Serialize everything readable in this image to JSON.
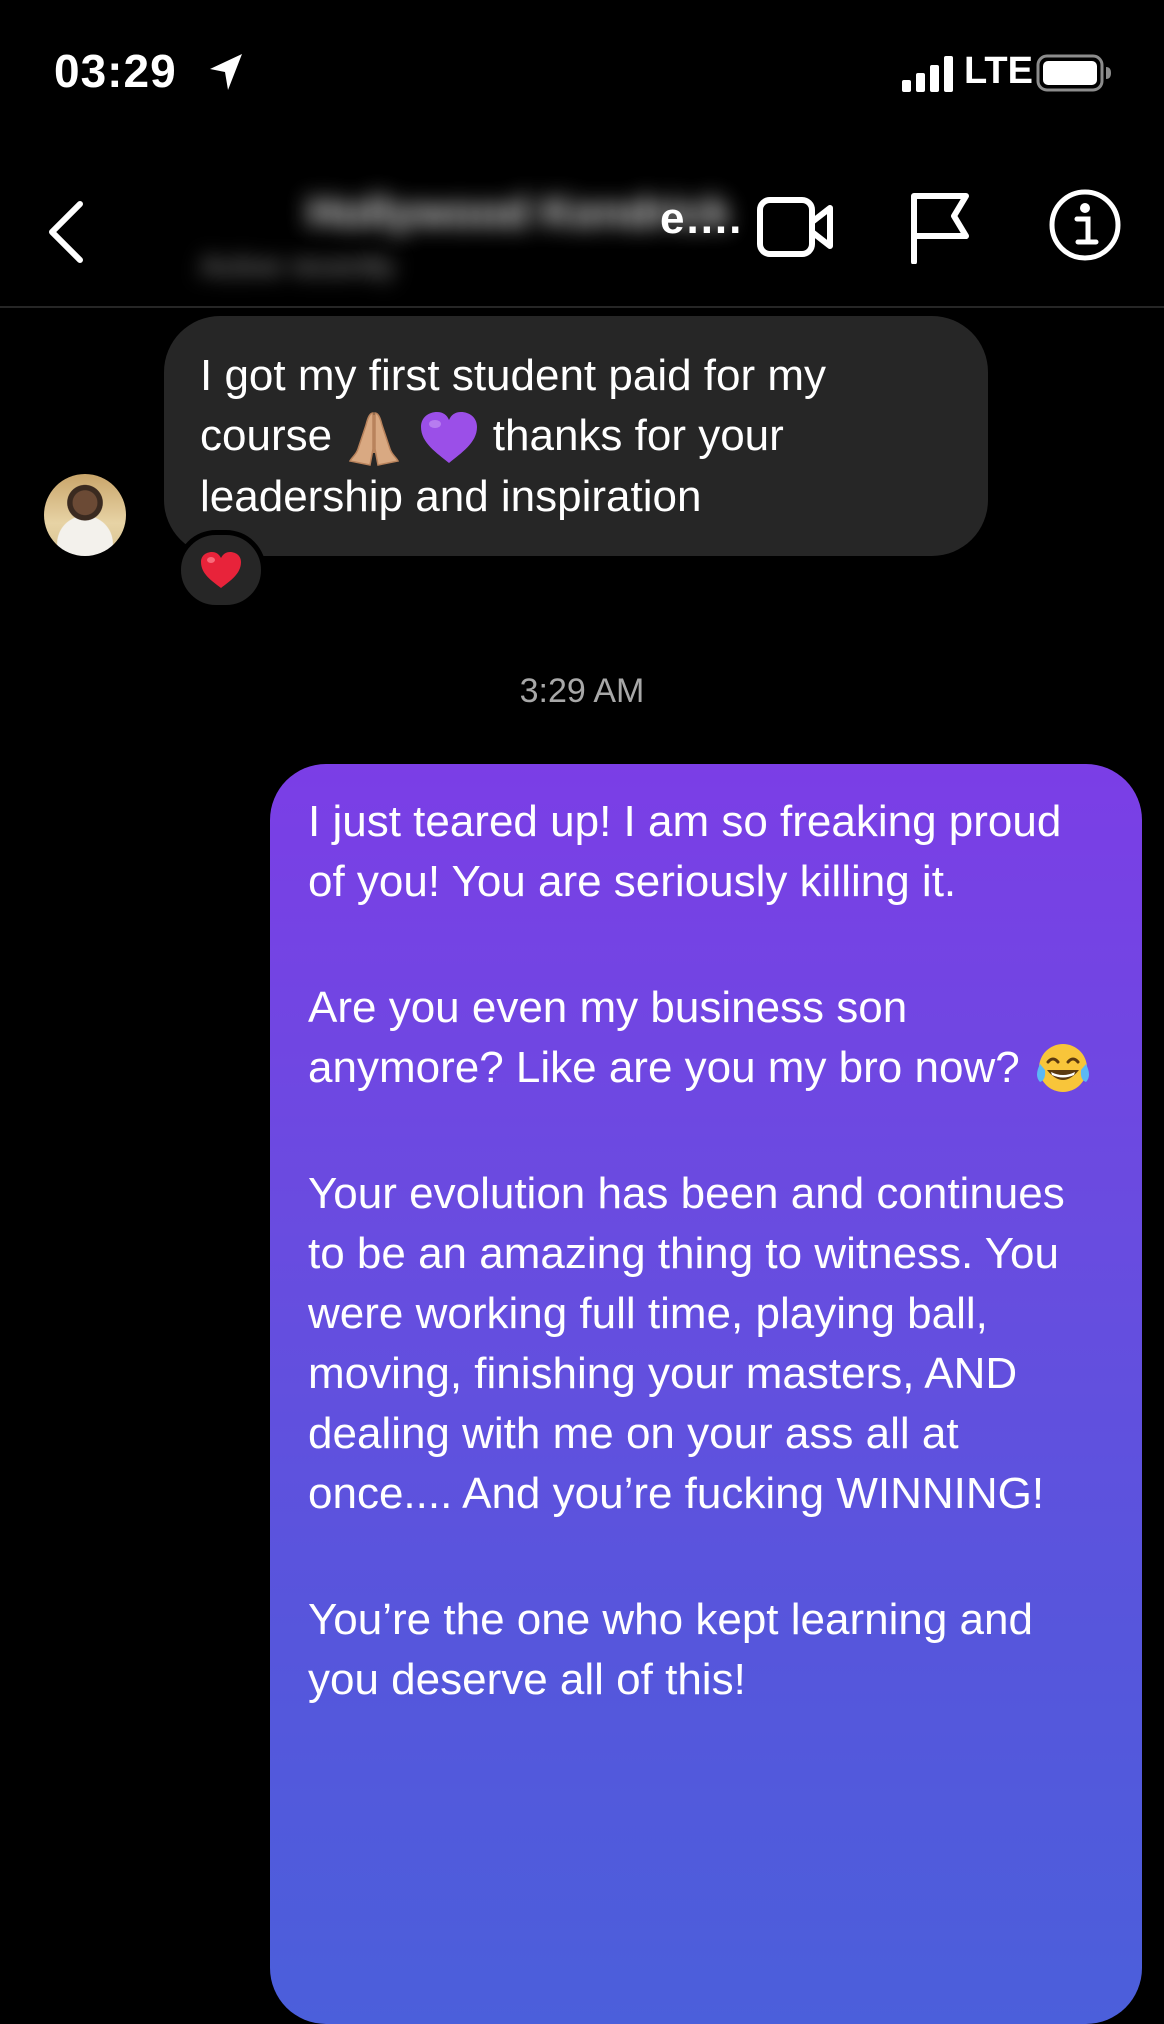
{
  "status_bar": {
    "time": "03:29",
    "network": "LTE",
    "icons": [
      "location-arrow-icon",
      "signal-bars-icon",
      "battery-icon"
    ]
  },
  "header": {
    "contact_name": "Hollywood Kendrick",
    "contact_subtitle": "Active recently",
    "name_ellipsis": "e....",
    "icons": [
      "chevron-left-icon",
      "video-camera-icon",
      "flag-icon",
      "info-icon"
    ]
  },
  "conversation": {
    "incoming": {
      "line1": "I got my first student paid for my",
      "line2_before": "course",
      "line2_after": "thanks for your",
      "line3": "leadership and inspiration",
      "emojis": [
        "praying-hands-emoji",
        "purple-heart-emoji"
      ],
      "reaction": "red-heart-emoji"
    },
    "timestamp": "3:29 AM",
    "outgoing": {
      "p1": "I just teared up! I am so freaking proud of you! You are seriously killing it.",
      "p2": "Are you even my business son anymore? Like are you my bro now?",
      "p2_emoji": "tears-of-joy-emoji",
      "p3": "Your evolution has been and continues to be an amazing thing to witness. You were working full time, playing ball, moving, finishing your masters, AND dealing with me on your ass all at once.... And you’re fucking WINNING!",
      "p4": "You’re the one who kept learning and you deserve all of this!"
    }
  },
  "colors": {
    "background": "#000000",
    "incoming_bubble": "#262626",
    "outgoing_gradient_top": "#7b3ee6",
    "outgoing_gradient_bottom": "#4b5fdb",
    "timestamp": "#a8a8a8"
  }
}
